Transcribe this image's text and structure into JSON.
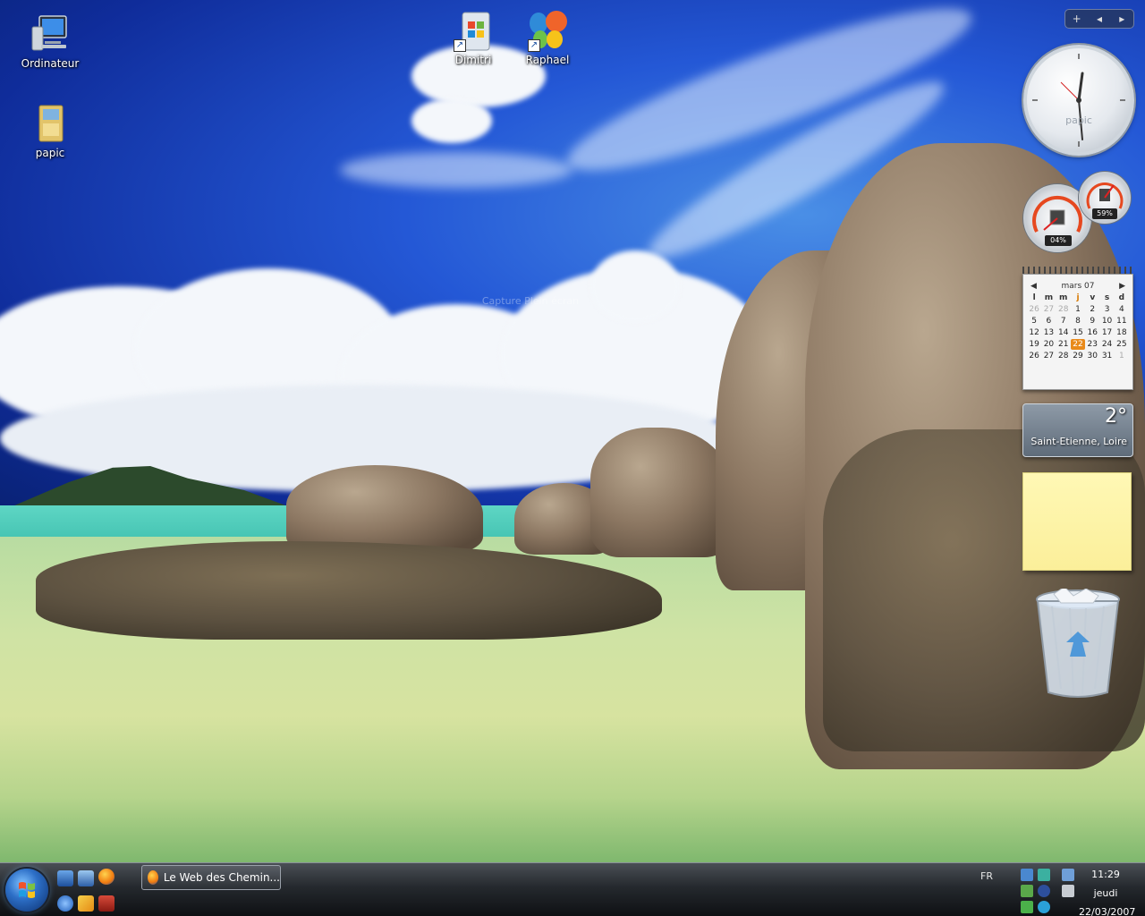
{
  "desktop": {
    "icons": [
      {
        "label": "Ordinateur",
        "icon": "computer-icon"
      },
      {
        "label": "papic",
        "icon": "folder-icon"
      },
      {
        "label": "Dimitri",
        "icon": "windows-shortcut-icon"
      },
      {
        "label": "Raphael",
        "icon": "msn-butterfly-icon"
      }
    ],
    "watermark": "Capture Plein écran"
  },
  "sidebar": {
    "controls": {
      "add": "+",
      "prev": "◂",
      "next": "▸"
    },
    "clock": {
      "label": "papic",
      "time": "11:29"
    },
    "cpu_meter": {
      "cpu": "04%",
      "memory": "59%"
    },
    "calendar": {
      "month": "mars 07",
      "prev": "◀",
      "next": "▶",
      "weekdays": [
        "l",
        "m",
        "m",
        "j",
        "v",
        "s",
        "d"
      ],
      "days": [
        "26",
        "27",
        "28",
        "1",
        "2",
        "3",
        "4",
        "5",
        "6",
        "7",
        "8",
        "9",
        "10",
        "11",
        "12",
        "13",
        "14",
        "15",
        "16",
        "17",
        "18",
        "19",
        "20",
        "21",
        "22",
        "23",
        "24",
        "25",
        "26",
        "27",
        "28",
        "29",
        "30",
        "31",
        "1"
      ],
      "today": "22"
    },
    "weather": {
      "temp": "2°",
      "city": "Saint-Etienne, Loire"
    },
    "note": {
      "text": ""
    }
  },
  "taskbar": {
    "task_button": "Le Web des Chemin...",
    "language": "FR",
    "clock": {
      "time": "11:29",
      "day": "jeudi",
      "date": "22/03/2007"
    }
  },
  "colors": {
    "accent": "#2d6fc7",
    "today": "#e98a1a",
    "note": "#fbef9a"
  }
}
